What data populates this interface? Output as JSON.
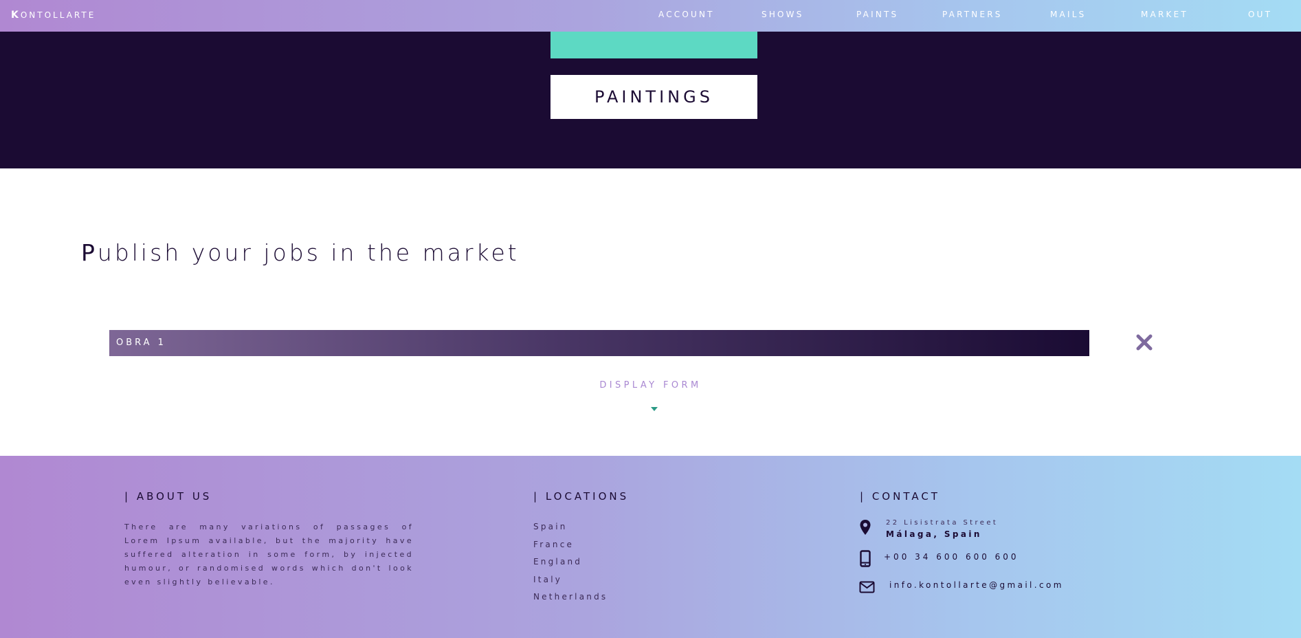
{
  "nav": {
    "brand_first": "K",
    "brand_rest": "ontollarte",
    "links": [
      "Account",
      "Shows",
      "Paints",
      "Partners",
      "Mails",
      "Market",
      "Out"
    ]
  },
  "hero": {
    "title": "Paintings"
  },
  "main": {
    "title_first": "P",
    "title_rest": "ublish your jobs in the market",
    "item_label": "Obra 1",
    "close_symbol": "✖",
    "display_form": "Display Form"
  },
  "footer": {
    "about_heading": "| About us",
    "about_text": "There are many variations of passages of Lorem Ipsum available, but the majority have suffered alteration in some form, by injected humour, or randomised words which don't look even slightly believable.",
    "locations_heading": "| Locations",
    "locations": [
      "Spain",
      "France",
      "England",
      "Italy",
      "Netherlands"
    ],
    "contact_heading": "| Contact",
    "address_line1": "22 Lisistrata Street",
    "address_line2": "Málaga, Spain",
    "phone": "+00 34 600 600 600",
    "email": "info.kontollarte@gmail.com"
  },
  "colors": {
    "dark": "#1b0b33",
    "teal": "#5dd9c3",
    "lavender": "#a988d2",
    "gradient_start": "#b088d2",
    "gradient_end": "#a4dcf4"
  },
  "icons": {
    "location": "map-pin-icon",
    "phone": "phone-icon",
    "email": "envelope-icon",
    "close": "close-icon",
    "dropdown": "caret-down-icon"
  }
}
